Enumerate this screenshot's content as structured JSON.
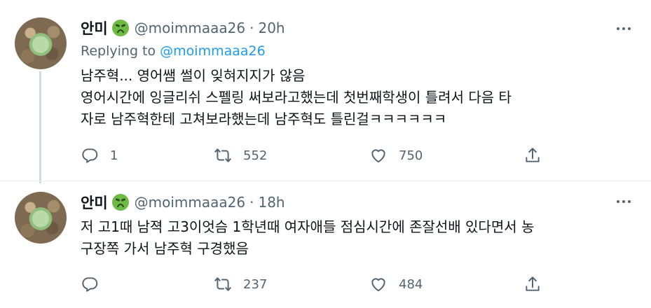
{
  "tweets": [
    {
      "name": "안미",
      "handle": "@moimmaaa26",
      "dot": "·",
      "time": "20h",
      "replying_prefix": "Replying to",
      "replying_to": "@moimmaaa26",
      "lines": [
        "남주혁... 영어쌤 썰이 잊혀지지가 않음",
        "영어시간에 잉글리쉬 스펠링 써보라고했는데 첫번째학생이 틀려서 다음 타",
        "자로 남주혁한테 고쳐보라했는데 남주혁도 틀린걸ㅋㅋㅋㅋㅋㅋ"
      ],
      "reply_count": "1",
      "retweet_count": "552",
      "like_count": "750"
    },
    {
      "name": "안미",
      "handle": "@moimmaaa26",
      "dot": "·",
      "time": "18h",
      "lines": [
        "저 고1때 남젹 고3이엇슴 1학년때 여자애들 점심시간에 존잘선배 있다면서 농",
        "구장쪽 가서 남주혁 구경했음"
      ],
      "reply_count": "",
      "retweet_count": "237",
      "like_count": "484"
    }
  ],
  "icons": {
    "author_emoji": "nauseated-face-icon",
    "reply": "reply-icon",
    "retweet": "retweet-icon",
    "like": "heart-icon",
    "share": "share-icon",
    "more": "more-icon"
  },
  "colors": {
    "text": "#0f1419",
    "secondary": "#536471",
    "link": "#1d9bf0",
    "thread_line": "#cfd9de"
  }
}
